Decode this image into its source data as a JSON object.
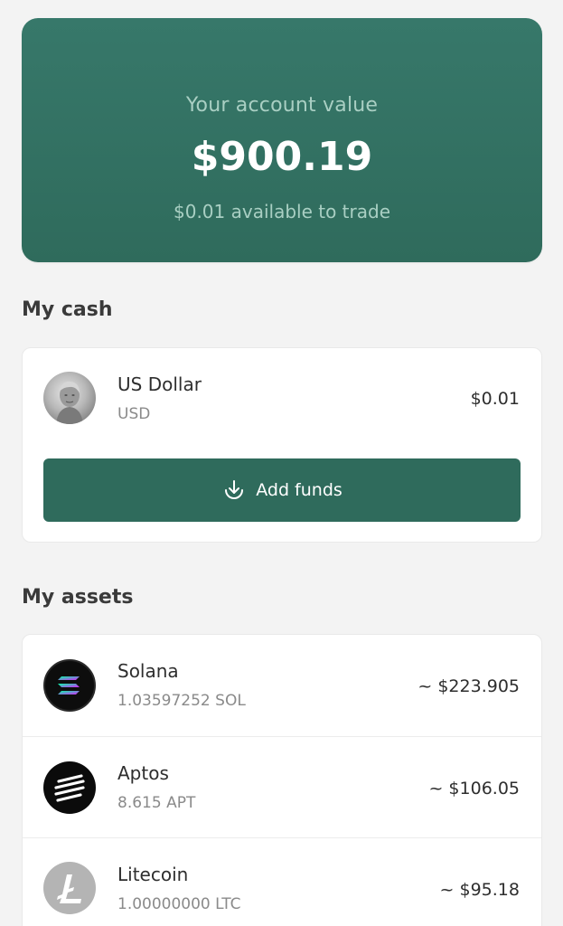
{
  "summary": {
    "label": "Your account value",
    "value": "$900.19",
    "available": "$0.01 available to trade"
  },
  "cash": {
    "title": "My cash",
    "currency": {
      "name": "US Dollar",
      "code": "USD",
      "amount": "$0.01",
      "icon": "us-dollar-bill-icon"
    },
    "add_funds_label": "Add funds",
    "add_funds_icon": "download-icon"
  },
  "assets": {
    "title": "My assets",
    "items": [
      {
        "name": "Solana",
        "holding": "1.03597252 SOL",
        "value": "~ $223.905",
        "icon": "solana-icon"
      },
      {
        "name": "Aptos",
        "holding": "8.615 APT",
        "value": "~ $106.05",
        "icon": "aptos-icon"
      },
      {
        "name": "Litecoin",
        "holding": "1.00000000 LTC",
        "value": "~ $95.18",
        "icon": "litecoin-icon"
      }
    ]
  },
  "colors": {
    "brand": "#2f6b5c",
    "background": "#f3f3f3"
  }
}
